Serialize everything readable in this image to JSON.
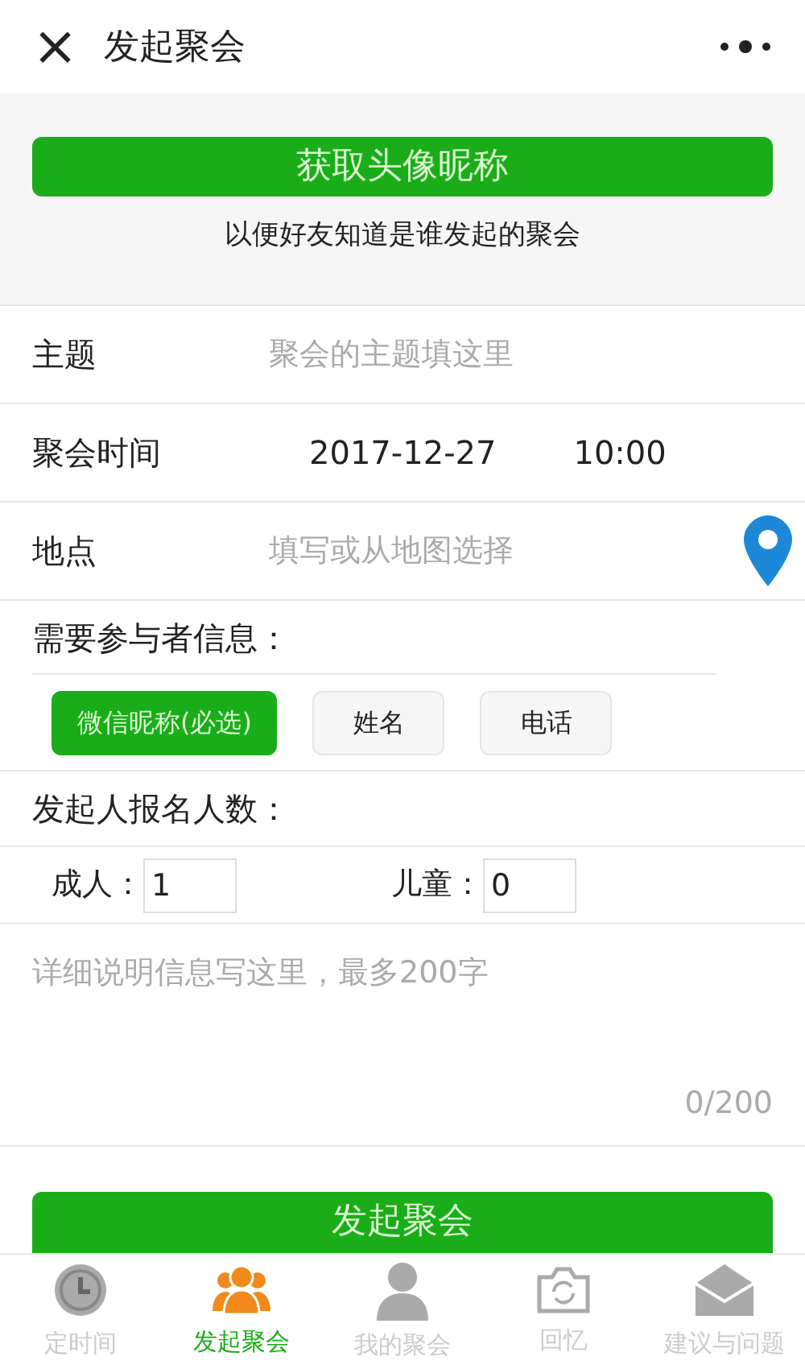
{
  "header": {
    "close": "×",
    "title": "发起聚会"
  },
  "avatar_button": {
    "label": "获取头像昵称",
    "hint": "以便好友知道是谁发起的聚会"
  },
  "fields": [
    {
      "kind": "input",
      "label": "主题",
      "placeholder": "聚会的主题填这里"
    },
    {
      "kind": "datetime",
      "label": "聚会时间",
      "date": "2017-12-27",
      "time": "10:00"
    },
    {
      "kind": "location",
      "label": "地点",
      "placeholder": "填写或从地图选择"
    }
  ],
  "participant_info": {
    "label": "需要参与者信息：",
    "options": [
      {
        "label": "微信昵称(必选)",
        "selected": true
      },
      {
        "label": "姓名",
        "selected": false
      },
      {
        "label": "电话",
        "selected": false
      }
    ]
  },
  "headcount": {
    "label": "发起人报名人数：",
    "adults": {
      "label": "成人：",
      "value": "1"
    },
    "children": {
      "label": "儿童：",
      "value": "0"
    }
  },
  "details": {
    "placeholder": "详细说明信息写这里，最多200字",
    "counter": "0/200"
  },
  "submit": "发起聚会",
  "tabs": [
    {
      "label": "定时间",
      "kind": "clock",
      "selected": false
    },
    {
      "label": "发起聚会",
      "kind": "group",
      "selected": true
    },
    {
      "label": "我的聚会",
      "kind": "person",
      "selected": false
    },
    {
      "label": "回忆",
      "kind": "camera",
      "selected": false
    },
    {
      "label": "建议与问题",
      "kind": "mail",
      "selected": false
    }
  ]
}
